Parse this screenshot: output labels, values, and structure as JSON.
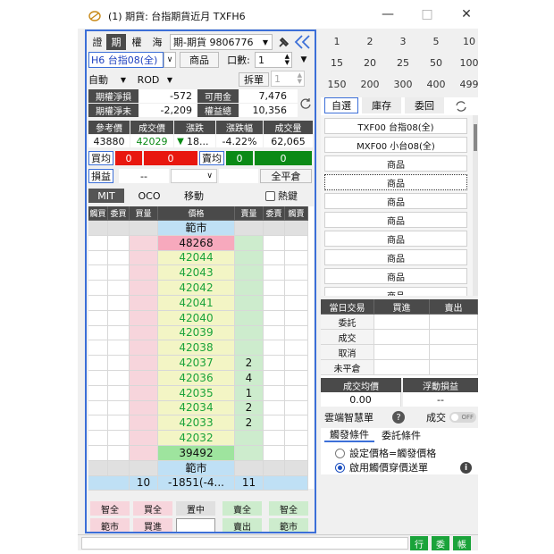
{
  "window": {
    "title": "(1) 期貨: 台指期貨近月 TXFH6",
    "minimize": "—",
    "maximize": "□",
    "close": "✕"
  },
  "tabs": [
    "證",
    "期",
    "權",
    "海"
  ],
  "account": "期-期貨 9806776",
  "product": "H6 台指08(全)",
  "product_btn": "商品",
  "qty_label": "口數:",
  "qty_value": "1",
  "auto": "自動",
  "rod": "ROD",
  "split": "拆單",
  "split_value": "1",
  "stats": [
    {
      "label": "期權淨損",
      "value": "-572",
      "label2": "可用金",
      "value2": "7,476"
    },
    {
      "label": "期權淨未",
      "value": "-2,209",
      "label2": "權益總",
      "value2": "10,356"
    }
  ],
  "quote_headers": [
    "參考價",
    "成交價",
    "漲跌",
    "漲跌幅",
    "成交量"
  ],
  "quote_values": {
    "ref": "43880",
    "last": "42029",
    "arrow": "▼",
    "chg": "18...",
    "pct": "-4.22%",
    "vol": "62,065"
  },
  "buy_avg": "買均",
  "buy_zero": "0",
  "buy_zero2": "0",
  "sell_avg": "賣均",
  "sell_zero": "0",
  "sell_zero2": "0",
  "pnl_btn": "損益",
  "pnl_val": "--",
  "close_all": "全平倉",
  "order_tabs": [
    "MIT",
    "OCO",
    "移動"
  ],
  "hotkey": "熱鍵",
  "ladder_headers": [
    "觸買",
    "委買",
    "買量",
    "價格",
    "賣量",
    "委賣",
    "觸賣"
  ],
  "ladder_prices": [
    "範市",
    "48268",
    "42044",
    "42043",
    "42042",
    "42041",
    "42040",
    "42039",
    "42038",
    "42037",
    "42036",
    "42035",
    "42034",
    "42033",
    "42032",
    "39492",
    "範市"
  ],
  "ladder_sell_qty": [
    "",
    "",
    "",
    "",
    "",
    "",
    "",
    "",
    "",
    "2",
    "4",
    "1",
    "2",
    "2",
    "",
    "",
    ""
  ],
  "ladder_total": {
    "buy": "10",
    "price": "-1851(-4...",
    "sell": "11"
  },
  "bottom_row1": [
    "智全",
    "買全",
    "置中",
    "賣全",
    "智全"
  ],
  "bottom_row2": [
    "範市",
    "買進",
    "",
    "賣出",
    "範市"
  ],
  "num_row1": [
    "1",
    "2",
    "3",
    "5",
    "10"
  ],
  "num_row2": [
    "15",
    "20",
    "25",
    "50",
    "100"
  ],
  "num_row3": [
    "150",
    "200",
    "300",
    "400",
    "499"
  ],
  "right_tabs": [
    "自選",
    "庫存",
    "委回"
  ],
  "products": [
    "TXF00 台指08(全)",
    "MXF00 小台08(全)",
    "商品",
    "商品",
    "商品",
    "商品",
    "商品",
    "商品",
    "商品",
    "商品"
  ],
  "trade_headers": [
    "當日交易",
    "買進",
    "賣出"
  ],
  "trade_rows": [
    "委託",
    "成交",
    "取消",
    "未平倉"
  ],
  "avg_headers": [
    "成交均價",
    "浮動損益"
  ],
  "avg_values": [
    "0.00",
    "--"
  ],
  "smart": {
    "title": "雲端智慧單",
    "help": "?",
    "fill_label": "成交",
    "toggle": "OFF"
  },
  "cond_tabs": [
    "觸發條件",
    "委託條件"
  ],
  "radios": [
    "設定價格=觸發價格",
    "啟用觸價穿價送單"
  ],
  "info": "i",
  "status_btns": [
    "行",
    "委",
    "帳"
  ],
  "colors": {
    "blue_border": "#3c6fd8",
    "red": "#e8170f",
    "green": "#0b8a16",
    "price_yellow": "#f3f5c5",
    "price_text": "#1aa33a",
    "buy_pink": "#f7d5dc",
    "sell_green": "#cdeccd"
  }
}
